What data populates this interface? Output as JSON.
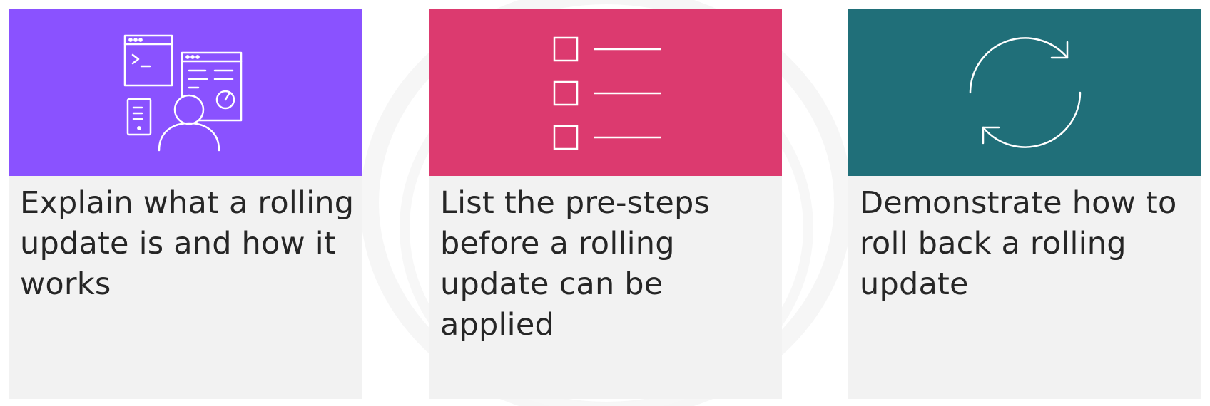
{
  "cards": [
    {
      "icon": "developer-dashboard-icon",
      "color": "#8a52ff",
      "text": "Explain what a rolling update is and how it works"
    },
    {
      "icon": "checklist-icon",
      "color": "#dc3a6f",
      "text": "List the pre-steps before a rolling update can be applied"
    },
    {
      "icon": "refresh-cycle-icon",
      "color": "#206f79",
      "text": "Demonstrate how to roll back a rolling update"
    }
  ]
}
